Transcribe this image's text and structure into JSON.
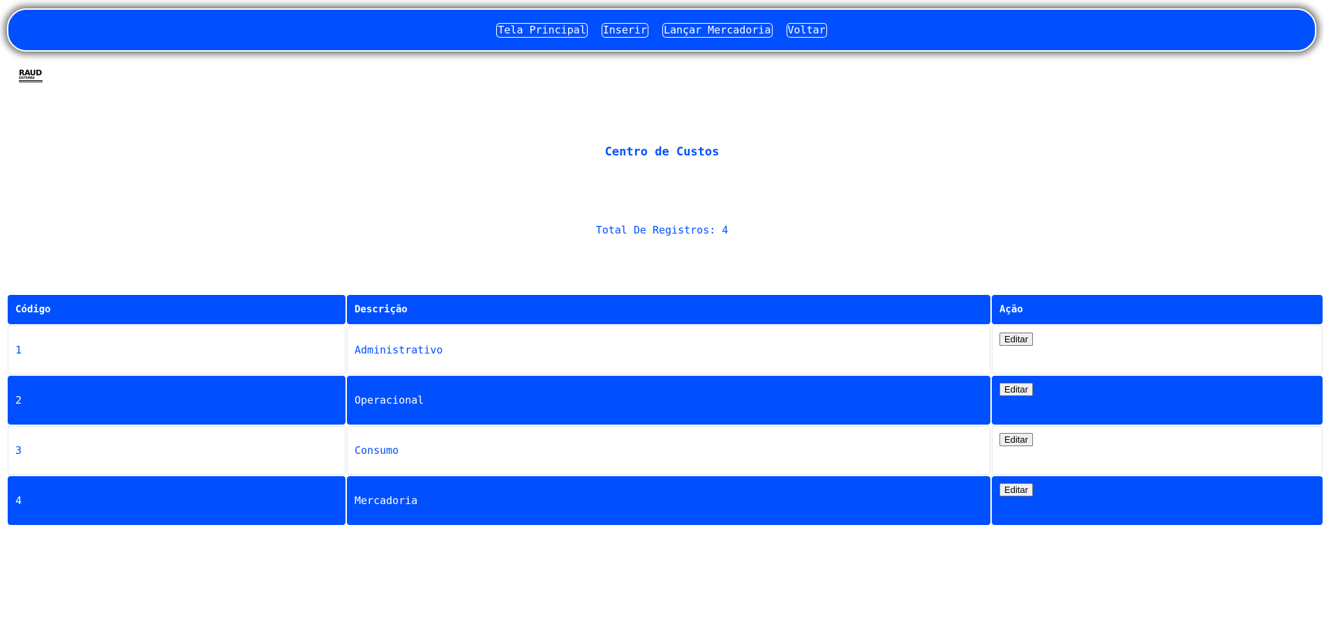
{
  "nav": {
    "items": [
      {
        "label": "Tela Principal"
      },
      {
        "label": "Inserir"
      },
      {
        "label": "Lançar Mercadoria"
      },
      {
        "label": "Voltar"
      }
    ]
  },
  "logo": {
    "name": "RAUD",
    "subtitle": "SISTEMAS"
  },
  "page": {
    "title": "Centro de Custos",
    "total_label": "Total De Registros: 4"
  },
  "table": {
    "columns": [
      "Código",
      "Descrição",
      "Ação"
    ],
    "rows": [
      {
        "codigo": "1",
        "descricao": "Administrativo",
        "acao": "Editar"
      },
      {
        "codigo": "2",
        "descricao": "Operacional",
        "acao": "Editar"
      },
      {
        "codigo": "3",
        "descricao": "Consumo",
        "acao": "Editar"
      },
      {
        "codigo": "4",
        "descricao": "Mercadoria",
        "acao": "Editar"
      }
    ]
  },
  "colors": {
    "primary": "#0050ff",
    "background": "#ffffff"
  }
}
